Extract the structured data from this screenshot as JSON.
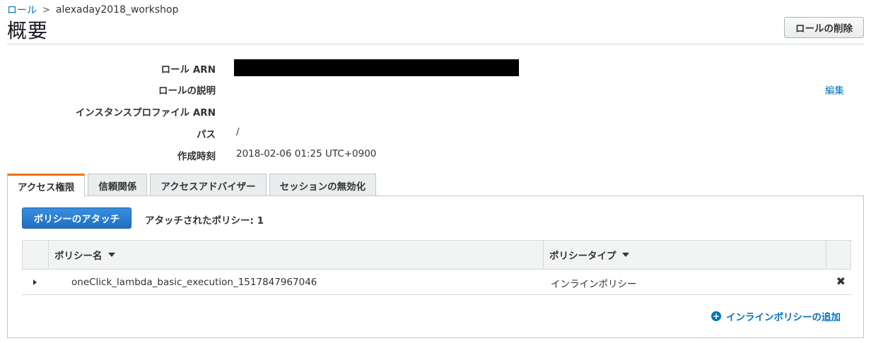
{
  "breadcrumb": {
    "parent": "ロール",
    "separator": ">",
    "current": "alexaday2018_workshop"
  },
  "page_title": "概要",
  "header_actions": {
    "delete_label": "ロールの削除"
  },
  "summary": {
    "role_arn_label": "ロール ARN",
    "description_label": "ロールの説明",
    "instance_profile_label": "インスタンスプロファイル ARN",
    "path_label": "パス",
    "path_value": "/",
    "created_label": "作成時刻",
    "created_value": "2018-02-06 01:25 UTC+0900",
    "edit_label": "編集"
  },
  "tabs": [
    {
      "label": "アクセス権限",
      "active": true
    },
    {
      "label": "信頼関係",
      "active": false
    },
    {
      "label": "アクセスアドバイザー",
      "active": false
    },
    {
      "label": "セッションの無効化",
      "active": false
    }
  ],
  "permissions": {
    "attach_button": "ポリシーのアタッチ",
    "attached_count": "アタッチされたポリシー: 1",
    "columns": {
      "name": "ポリシー名",
      "type": "ポリシータイプ"
    },
    "rows": [
      {
        "name": "oneClick_lambda_basic_execution_1517847967046",
        "type": "インラインポリシー"
      }
    ],
    "add_inline_label": "インラインポリシーの追加"
  },
  "colors": {
    "link": "#0073bb",
    "active_tab_accent": "#ec7211",
    "primary_button": "#1f6fc4"
  }
}
